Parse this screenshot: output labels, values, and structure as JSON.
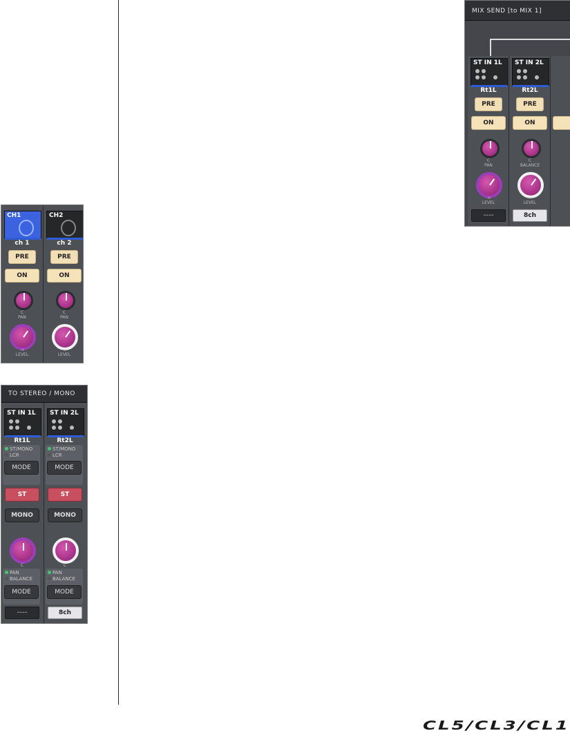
{
  "mix_send": {
    "title": "MIX SEND [to MIX 1]",
    "channels": [
      {
        "thumb": "ST IN 1L",
        "name": "Rt1L",
        "pre": "PRE",
        "on": "ON",
        "knob_label": "C\nPAN",
        "level_label": "-∞\nLEVEL",
        "bottom": "----"
      },
      {
        "thumb": "ST IN 2L",
        "name": "Rt2L",
        "pre": "PRE",
        "on": "ON",
        "knob_label": "C\nBALANCE",
        "level_label": "-∞\nLEVEL",
        "bottom": "8ch"
      }
    ]
  },
  "ch_strips": {
    "channels": [
      {
        "thumb": "CH1",
        "name": "ch 1",
        "pre": "PRE",
        "on": "ON",
        "knob_label": "C\nPAN",
        "level_label": "-∞\nLEVEL"
      },
      {
        "thumb": "CH2",
        "name": "ch 2",
        "pre": "PRE",
        "on": "ON",
        "knob_label": "C\nPAN",
        "level_label": "-∞\nLEVEL"
      }
    ]
  },
  "to_stereo": {
    "title": "TO STEREO / MONO",
    "channels": [
      {
        "thumb": "ST IN 1L",
        "name": "Rt1L",
        "led1": "ST/MONO",
        "led2": "LCR",
        "mode": "MODE",
        "st": "ST",
        "mono": "MONO",
        "knob_label": "C",
        "led3": "PAN",
        "led4": "BALANCE",
        "mode2": "MODE",
        "bottom": "----"
      },
      {
        "thumb": "ST IN 2L",
        "name": "Rt2L",
        "led1": "ST/MONO",
        "led2": "LCR",
        "mode": "MODE",
        "st": "ST",
        "mono": "MONO",
        "knob_label": "C",
        "led3": "PAN",
        "led4": "BALANCE",
        "mode2": "MODE",
        "bottom": "8ch"
      }
    ]
  },
  "footer": {
    "logo": "CL5/CL3/CL1"
  }
}
